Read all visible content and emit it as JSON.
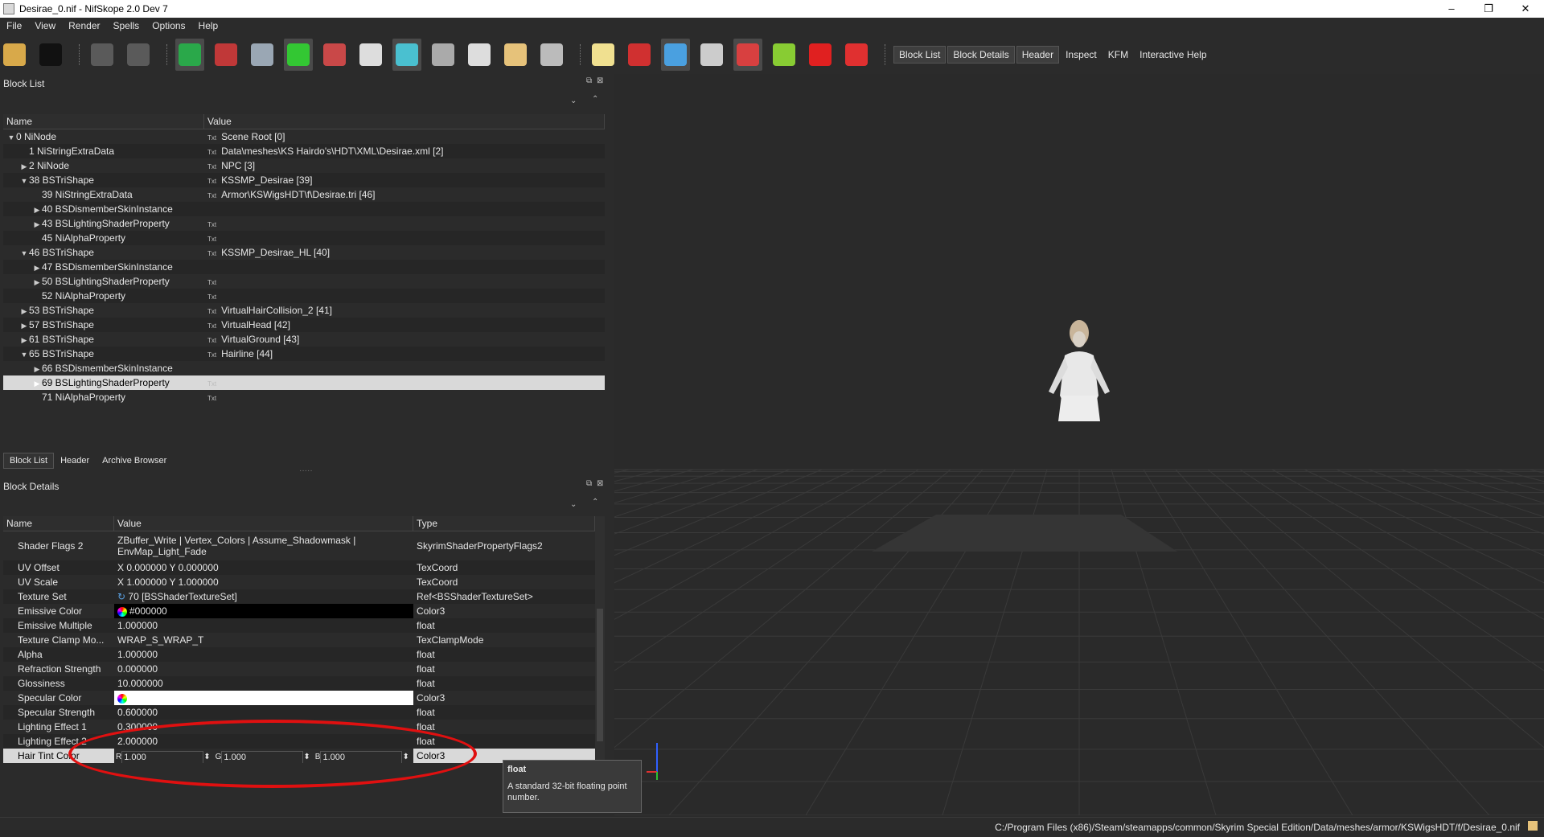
{
  "window": {
    "title": "Desirae_0.nif - NifSkope 2.0 Dev 7",
    "controls": [
      "–",
      "❐",
      "✕"
    ]
  },
  "menu": [
    "File",
    "View",
    "Render",
    "Spells",
    "Options",
    "Help"
  ],
  "toolbar": {
    "icons": [
      {
        "name": "load-icon",
        "color": "#d8a94a",
        "active": false
      },
      {
        "name": "save-icon",
        "color": "#111111",
        "active": false
      },
      {
        "name": "undo-icon",
        "color": "#5a5a5a",
        "active": false
      },
      {
        "name": "redo-icon",
        "color": "#5a5a5a",
        "active": false
      },
      {
        "name": "select-object-icon",
        "color": "#2aa84a",
        "active": true
      },
      {
        "name": "select-vertex-icon",
        "color": "#c03838",
        "active": false
      },
      {
        "name": "view-top-icon",
        "color": "#9aa7b4",
        "active": false
      },
      {
        "name": "view-front-icon",
        "color": "#33c733",
        "active": true
      },
      {
        "name": "view-side-icon",
        "color": "#c94848",
        "active": false
      },
      {
        "name": "view-user-icon",
        "color": "#dddddd",
        "active": false
      },
      {
        "name": "view-flip-icon",
        "color": "#4ac0d0",
        "active": true
      },
      {
        "name": "walk-icon",
        "color": "#aaaaaa",
        "active": false
      },
      {
        "name": "show-hidden-icon",
        "color": "#dddddd",
        "active": false
      },
      {
        "name": "show-selected-icon",
        "color": "#e6c27a",
        "active": false
      },
      {
        "name": "screenshot-icon",
        "color": "#bbbbbb",
        "active": false
      },
      {
        "name": "lighting-icon",
        "color": "#f0e090",
        "active": false
      },
      {
        "name": "show-axes-icon",
        "color": "#d03030",
        "active": false
      },
      {
        "name": "show-nodes-icon",
        "color": "#4aa0e0",
        "active": true
      },
      {
        "name": "show-skeleton-icon",
        "color": "#cccccc",
        "active": false
      },
      {
        "name": "show-havok-icon",
        "color": "#d84040",
        "active": true
      },
      {
        "name": "show-constraints-icon",
        "color": "#88cc33",
        "active": false
      },
      {
        "name": "show-markers-icon",
        "color": "#e02020",
        "active": false
      },
      {
        "name": "disable-shading-icon",
        "color": "#e03030",
        "active": false
      }
    ],
    "text_buttons": [
      {
        "label": "Block List",
        "active": true
      },
      {
        "label": "Block Details",
        "active": true
      },
      {
        "label": "Header",
        "active": true
      },
      {
        "label": "Inspect",
        "active": false
      },
      {
        "label": "KFM",
        "active": false
      },
      {
        "label": "Interactive Help",
        "active": false
      }
    ]
  },
  "block_list": {
    "title": "Block List",
    "columns": [
      "Name",
      "Value"
    ],
    "rows": [
      {
        "indent": 0,
        "toggle": "▼",
        "name": "0 NiNode",
        "txt": "Txt",
        "value": "Scene Root [0]",
        "selected": false
      },
      {
        "indent": 1,
        "toggle": "",
        "name": "1 NiStringExtraData",
        "txt": "Txt",
        "value": "Data\\meshes\\KS Hairdo's\\HDT\\XML\\Desirae.xml [2]",
        "selected": false
      },
      {
        "indent": 1,
        "toggle": "▶",
        "name": "2 NiNode",
        "txt": "Txt",
        "value": "NPC [3]",
        "selected": false
      },
      {
        "indent": 1,
        "toggle": "▼",
        "name": "38 BSTriShape",
        "txt": "Txt",
        "value": "KSSMP_Desirae [39]",
        "selected": false
      },
      {
        "indent": 2,
        "toggle": "",
        "name": "39 NiStringExtraData",
        "txt": "Txt",
        "value": "Armor\\KSWigsHDT\\f\\Desirae.tri [46]",
        "selected": false
      },
      {
        "indent": 2,
        "toggle": "▶",
        "name": "40 BSDismemberSkinInstance",
        "txt": "",
        "value": "",
        "selected": false
      },
      {
        "indent": 2,
        "toggle": "▶",
        "name": "43 BSLightingShaderProperty",
        "txt": "Txt",
        "value": "",
        "selected": false
      },
      {
        "indent": 2,
        "toggle": "",
        "name": "45 NiAlphaProperty",
        "txt": "Txt",
        "value": "",
        "selected": false
      },
      {
        "indent": 1,
        "toggle": "▼",
        "name": "46 BSTriShape",
        "txt": "Txt",
        "value": "KSSMP_Desirae_HL [40]",
        "selected": false
      },
      {
        "indent": 2,
        "toggle": "▶",
        "name": "47 BSDismemberSkinInstance",
        "txt": "",
        "value": "",
        "selected": false
      },
      {
        "indent": 2,
        "toggle": "▶",
        "name": "50 BSLightingShaderProperty",
        "txt": "Txt",
        "value": "",
        "selected": false
      },
      {
        "indent": 2,
        "toggle": "",
        "name": "52 NiAlphaProperty",
        "txt": "Txt",
        "value": "",
        "selected": false
      },
      {
        "indent": 1,
        "toggle": "▶",
        "name": "53 BSTriShape",
        "txt": "Txt",
        "value": "VirtualHairCollision_2 [41]",
        "selected": false
      },
      {
        "indent": 1,
        "toggle": "▶",
        "name": "57 BSTriShape",
        "txt": "Txt",
        "value": "VirtualHead [42]",
        "selected": false
      },
      {
        "indent": 1,
        "toggle": "▶",
        "name": "61 BSTriShape",
        "txt": "Txt",
        "value": "VirtualGround [43]",
        "selected": false
      },
      {
        "indent": 1,
        "toggle": "▼",
        "name": "65 BSTriShape",
        "txt": "Txt",
        "value": "Hairline [44]",
        "selected": false
      },
      {
        "indent": 2,
        "toggle": "▶",
        "name": "66 BSDismemberSkinInstance",
        "txt": "",
        "value": "",
        "selected": false
      },
      {
        "indent": 2,
        "toggle": "▶",
        "name": "69 BSLightingShaderProperty",
        "txt": "Txt",
        "value": "",
        "selected": true
      },
      {
        "indent": 2,
        "toggle": "",
        "name": "71 NiAlphaProperty",
        "txt": "Txt",
        "value": "",
        "selected": false
      }
    ]
  },
  "tabs": [
    {
      "label": "Block List",
      "active": true
    },
    {
      "label": "Header",
      "active": false
    },
    {
      "label": "Archive Browser",
      "active": false
    }
  ],
  "block_details": {
    "title": "Block Details",
    "columns": [
      "Name",
      "Value",
      "Type"
    ],
    "rows": [
      {
        "name": "Shader Flags 2",
        "value": "ZBuffer_Write | Vertex_Colors | Assume_Shadowmask |",
        "value2": "EnvMap_Light_Fade",
        "type": "SkyrimShaderPropertyFlags2",
        "kind": "multi"
      },
      {
        "name": "UV Offset",
        "value": "X 0.000000 Y 0.000000",
        "type": "TexCoord",
        "kind": "text"
      },
      {
        "name": "UV Scale",
        "value": "X 1.000000 Y 1.000000",
        "type": "TexCoord",
        "kind": "text"
      },
      {
        "name": "Texture Set",
        "value": "70 [BSShaderTextureSet]",
        "type": "Ref<BSShaderTextureSet>",
        "kind": "ref"
      },
      {
        "name": "Emissive Color",
        "value": "#000000",
        "type": "Color3",
        "kind": "color",
        "color": "#000000"
      },
      {
        "name": "Emissive Multiple",
        "value": "1.000000",
        "type": "float",
        "kind": "text"
      },
      {
        "name": "Texture Clamp Mo...",
        "value": "WRAP_S_WRAP_T",
        "type": "TexClampMode",
        "kind": "text"
      },
      {
        "name": "Alpha",
        "value": "1.000000",
        "type": "float",
        "kind": "text"
      },
      {
        "name": "Refraction Strength",
        "value": "0.000000",
        "type": "float",
        "kind": "text"
      },
      {
        "name": "Glossiness",
        "value": "10.000000",
        "type": "float",
        "kind": "text"
      },
      {
        "name": "Specular Color",
        "value": "",
        "type": "Color3",
        "kind": "color",
        "color": "#ffffff"
      },
      {
        "name": "Specular Strength",
        "value": "0.600000",
        "type": "float",
        "kind": "text"
      },
      {
        "name": "Lighting Effect 1",
        "value": "0.300000",
        "type": "float",
        "kind": "text"
      },
      {
        "name": "Lighting Effect 2",
        "value": "2.000000",
        "type": "float",
        "kind": "text"
      }
    ],
    "editing_row": {
      "name": "Hair Tint Color",
      "type": "Color3",
      "fields": [
        {
          "label": "R",
          "value": "1.000"
        },
        {
          "label": "G",
          "value": "1.000"
        },
        {
          "label": "B",
          "value": "1.000"
        }
      ]
    }
  },
  "tooltip": {
    "title": "float",
    "body": "A standard 32-bit floating point number."
  },
  "status": {
    "path": "C:/Program Files (x86)/Steam/steamapps/common/Skyrim Special Edition/Data/meshes/armor/KSWigsHDT/f/Desirae_0.nif"
  },
  "colors": {
    "background": "#2b2b2b",
    "selection": "#d9d9d9",
    "annotation": "#e01010"
  }
}
